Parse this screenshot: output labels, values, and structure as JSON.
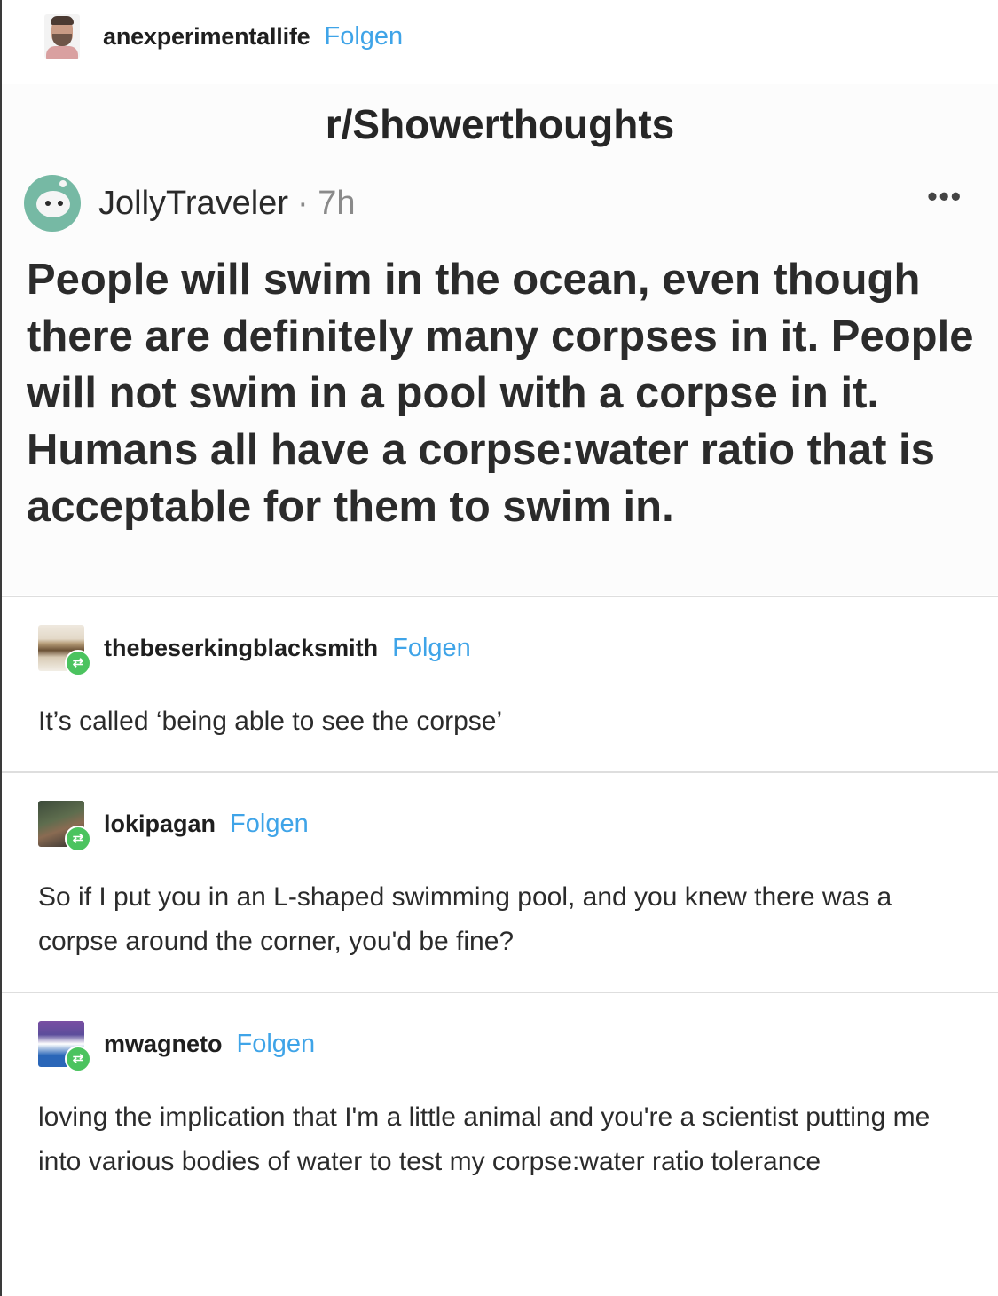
{
  "header": {
    "username": "anexperimentallife",
    "follow_label": "Folgen"
  },
  "quoted_post": {
    "subreddit": "r/Showerthoughts",
    "poster": "JollyTraveler",
    "time": "· 7h",
    "more_icon": "•••",
    "text": "People will swim in the ocean, even though there are definitely many corpses in it. People will not swim in a pool with a corpse in it. Humans all have a corpse:water ratio that is acceptable for them to swim in."
  },
  "reblogs": [
    {
      "username": "thebeserkingblacksmith",
      "follow_label": "Folgen",
      "text": "It’s called ‘being able to see the corpse’"
    },
    {
      "username": "lokipagan",
      "follow_label": "Folgen",
      "text": "So if I put you in an L-shaped swimming pool, and you knew there was a corpse around the corner, you'd be fine?"
    },
    {
      "username": "mwagneto",
      "follow_label": "Folgen",
      "text": "loving the implication that I'm a little animal and you're a scientist putting me into various bodies of water to test my corpse:water ratio tolerance"
    }
  ],
  "icons": {
    "reblog_badge": "⇄"
  },
  "colors": {
    "follow": "#3fa4e8",
    "reblog_badge": "#4bc35f"
  }
}
